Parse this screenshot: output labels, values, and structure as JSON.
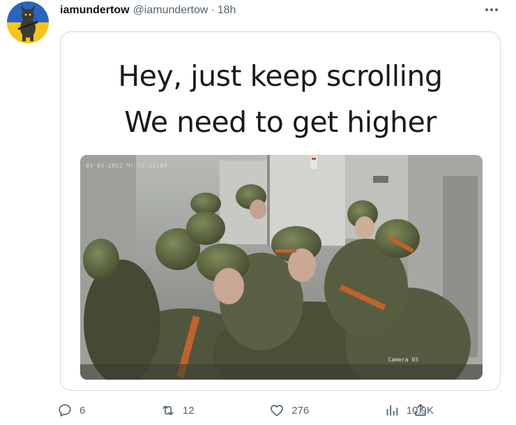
{
  "tweet": {
    "display_name": "iamundertow",
    "handle": "@iamundertow",
    "separator": "·",
    "time": "18h",
    "more_icon": "ellipsis-icon",
    "avatar_icon": "avatar-image"
  },
  "media": {
    "caption_line1": "Hey, just keep scrolling",
    "caption_line2": "We need to get higher",
    "cctv_timestamp": "03-03-2022 Чт 16:32:09",
    "camera_label": "Camera 03",
    "photo_description_icon": "photo-image"
  },
  "actions": {
    "reply": {
      "icon": "reply-icon",
      "count": "6"
    },
    "retweet": {
      "icon": "retweet-icon",
      "count": "12"
    },
    "like": {
      "icon": "heart-icon",
      "count": "276"
    },
    "views": {
      "icon": "views-chart-icon",
      "count": "10.9K"
    },
    "share": {
      "icon": "share-icon"
    }
  },
  "colors": {
    "text_primary": "#0f1419",
    "text_secondary": "#536471",
    "border": "#cfd9de"
  }
}
